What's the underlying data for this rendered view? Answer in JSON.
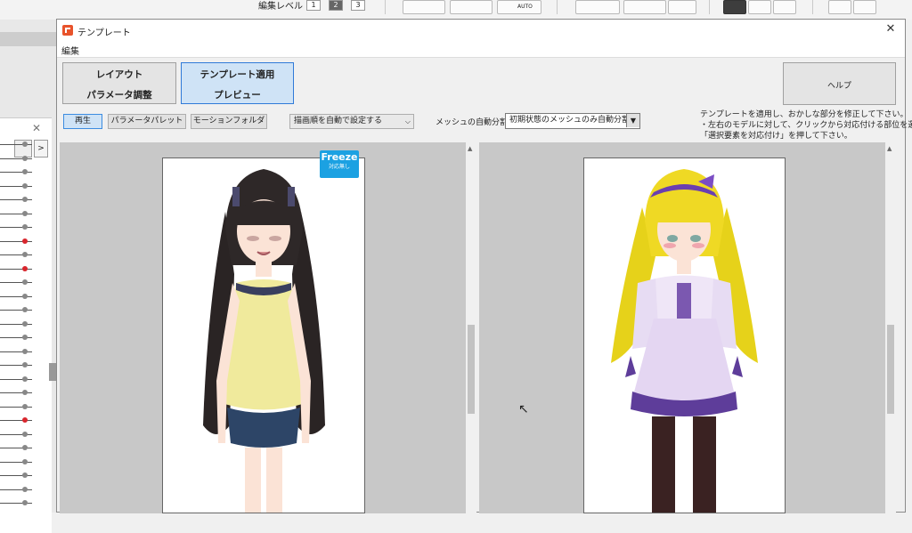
{
  "background_app": {
    "edit_level_label": "編集レベル :",
    "levels": [
      "1",
      "2",
      "3"
    ],
    "active_level": "2",
    "auto_label": "AUTO"
  },
  "window": {
    "title": "テンプレート",
    "close_glyph": "✕",
    "menu": [
      "編集"
    ]
  },
  "mode_buttons": {
    "layout": "レイアウト",
    "param_adjust": "パラメータ調整",
    "apply_template": "テンプレート適用",
    "preview": "プレビュー",
    "help": "ヘルプ"
  },
  "toolbar": {
    "play": "再生",
    "param_palette": "パラメータパレット",
    "motion_folder": "モーションフォルダ",
    "draw_order_select": "描画順を自動で設定する",
    "mesh_label": "メッシュの自動分割",
    "mesh_select": "初期状態のメッシュのみ自動分割"
  },
  "help_text": [
    "テンプレートを適用し、おかしな部分を修正して下さい。",
    "・左右のモデルに対して、クリックから対応付ける部位を選び、",
    "「選択要素を対応付け」を押して下さい。"
  ],
  "freeze_badge": {
    "title": "Freeze",
    "subtitle": "対応無し"
  },
  "colors": {
    "accent_blue": "#1ba1e2",
    "selected_button": "#cfe3f6",
    "app_icon": "#e8532b",
    "keyframe_red": "#d8262d"
  }
}
